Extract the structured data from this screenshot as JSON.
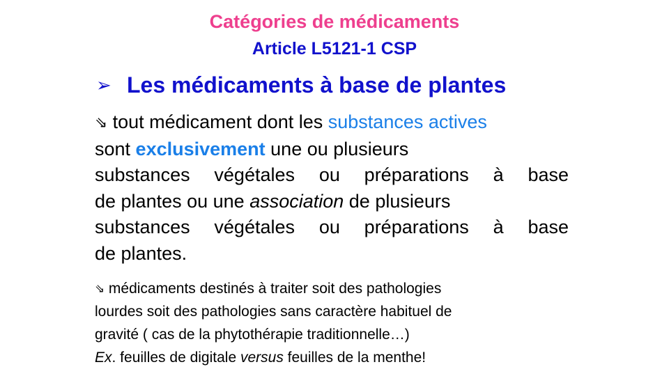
{
  "title_line1": "Catégories de médicaments",
  "title_line2": "Article L5121-1 CSP",
  "heading": {
    "bullet": "➢",
    "text": "Les médicaments à base de plantes"
  },
  "arrow_icon": "⇘",
  "para1": {
    "l1_pre": " tout médicament dont les ",
    "l1_hl": "substances actives",
    "l2_pre": "sont ",
    "l2_hl": "exclusivement",
    "l2_post": " une ou plusieurs",
    "l3": "substances végétales ou préparations à  base",
    "l4_pre": "de plantes ou une ",
    "l4_it": "association",
    "l4_post": " de plusieurs",
    "l5": "substances végétales ou préparations à  base",
    "l6": "de plantes."
  },
  "para2": {
    "l1": " médicaments destinés à traiter soit des pathologies",
    "l2": "lourdes soit des pathologies sans caractère habituel de",
    "l3": "gravité ( cas de la phytothérapie traditionnelle…)",
    "l4_ex": "Ex",
    "l4_a": ". feuilles de digitale ",
    "l4_versus": "versus",
    "l4_b": " feuilles de la menthe!"
  },
  "colors": {
    "title_pink": "#ee3f8e",
    "title_blue": "#1111cc",
    "highlight_blue": "#1a7fe8"
  }
}
